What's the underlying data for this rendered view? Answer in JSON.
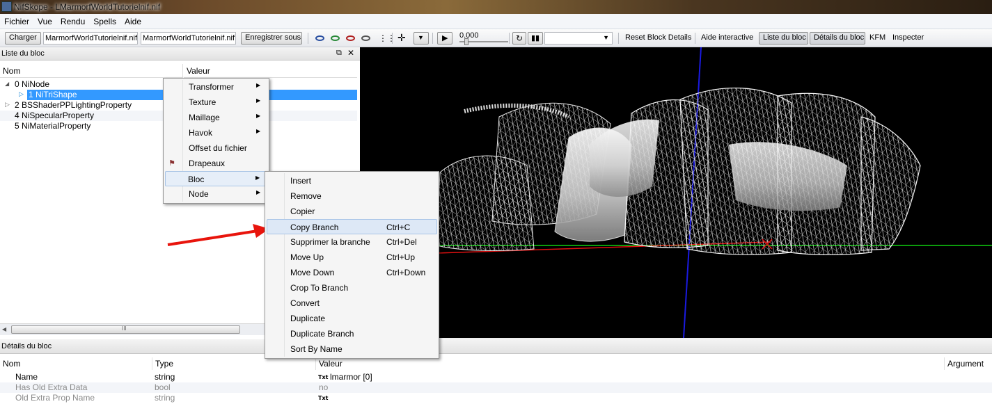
{
  "window": {
    "title": "NifSkope - LMarmorfWorldTutorielnif.nif"
  },
  "menubar": [
    "Fichier",
    "Vue",
    "Rendu",
    "Spells",
    "Aide"
  ],
  "toolbar": {
    "load_label": "Charger",
    "load_file": "MarmorfWorldTutorielnif.nif",
    "save_file": "MarmorfWorldTutorielnif.nif",
    "save_as_label": "Enregistrer sous",
    "time_value": "0.000",
    "reset_label": "Reset Block Details",
    "help_label": "Aide interactive",
    "block_list_label": "Liste du bloc",
    "block_details_label": "Détails du bloc",
    "kfm_label": "KFM",
    "inspect_label": "Inspecter"
  },
  "block_list": {
    "title": "Liste du bloc",
    "columns": [
      "Nom",
      "Valeur"
    ],
    "rows": [
      {
        "label": "0 NiNode"
      },
      {
        "label": "1 NiTriShape"
      },
      {
        "label": "2 BSShaderPPLightingProperty"
      },
      {
        "label": "4 NiSpecularProperty"
      },
      {
        "label": "5 NiMaterialProperty"
      }
    ],
    "scroll_grip": "III"
  },
  "block_details": {
    "title": "Détails du bloc",
    "columns": [
      "Nom",
      "Type",
      "Valeur",
      "Argument"
    ],
    "rows": [
      {
        "name": "Name",
        "type": "string",
        "icon": "Txt",
        "value": "lmarmor [0]"
      },
      {
        "name": "Has Old Extra Data",
        "type": "bool",
        "icon": "",
        "value": "no"
      },
      {
        "name": "Old Extra Prop Name",
        "type": "string",
        "icon": "Txt",
        "value": ""
      }
    ]
  },
  "context_menu": {
    "items": [
      "Transformer",
      "Texture",
      "Maillage",
      "Havok",
      "Offset du fichier",
      "Drapeaux",
      "Bloc",
      "Node"
    ]
  },
  "submenu": {
    "items": [
      {
        "label": "Insert",
        "shortcut": ""
      },
      {
        "label": "Remove",
        "shortcut": ""
      },
      {
        "label": "Copier",
        "shortcut": ""
      },
      {
        "label": "Copy Branch",
        "shortcut": "Ctrl+C"
      },
      {
        "label": "Supprimer la branche",
        "shortcut": "Ctrl+Del"
      },
      {
        "label": "Move Up",
        "shortcut": "Ctrl+Up"
      },
      {
        "label": "Move Down",
        "shortcut": "Ctrl+Down"
      },
      {
        "label": "Crop To Branch",
        "shortcut": ""
      },
      {
        "label": "Convert",
        "shortcut": ""
      },
      {
        "label": "Duplicate",
        "shortcut": ""
      },
      {
        "label": "Duplicate Branch",
        "shortcut": ""
      },
      {
        "label": "Sort By Name",
        "shortcut": ""
      }
    ]
  },
  "colors": {
    "selection": "#3399ff",
    "arrow": "#e8140c",
    "viewport_bg": "#000000",
    "axis_x": "#e01010",
    "axis_y": "#10d010",
    "axis_z": "#1a1ae0"
  }
}
